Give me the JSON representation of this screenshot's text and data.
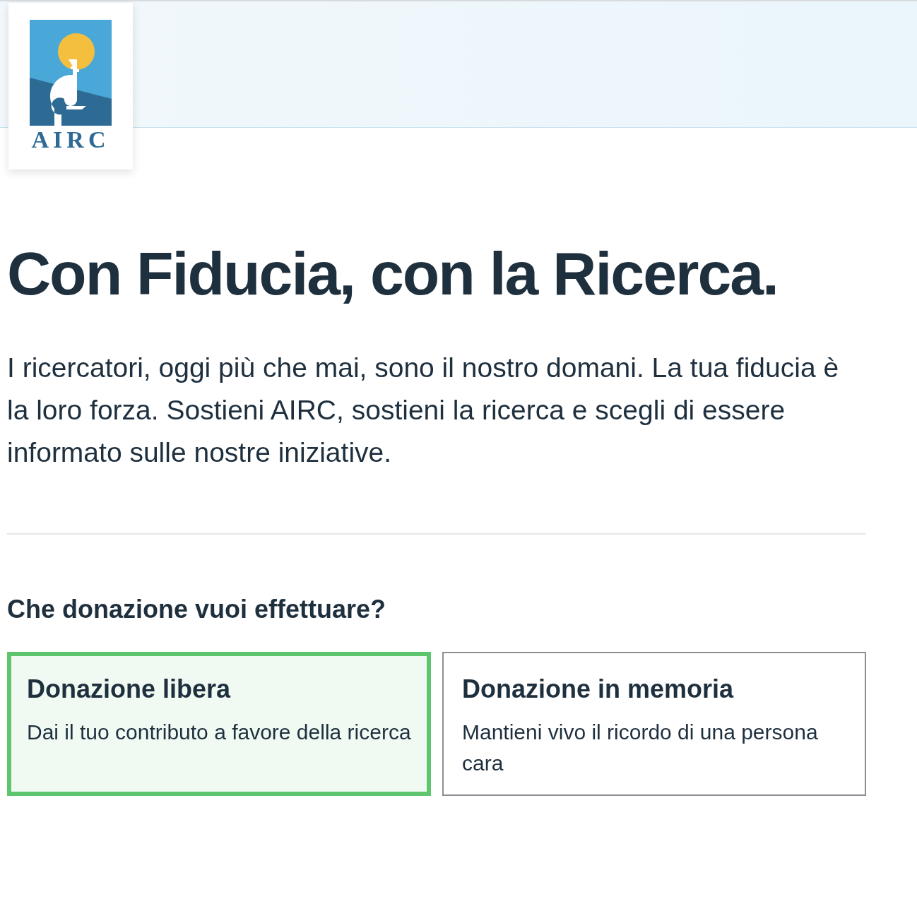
{
  "logo": {
    "text": "AIRC"
  },
  "title": "Con Fiducia, con la Ricerca.",
  "intro": "I ricercatori, oggi più che mai, sono il nostro domani. La tua fiducia è la loro forza. Sostieni AIRC, sostieni la ricerca e scegli di essere informato sulle nostre iniziative.",
  "question": "Che donazione vuoi effettuare?",
  "options": [
    {
      "title": "Donazione libera",
      "description": "Dai il tuo contributo a favore della ricerca",
      "selected": true
    },
    {
      "title": "Donazione in memoria",
      "description": "Mantieni vivo il ricordo di una persona cara",
      "selected": false
    }
  ]
}
